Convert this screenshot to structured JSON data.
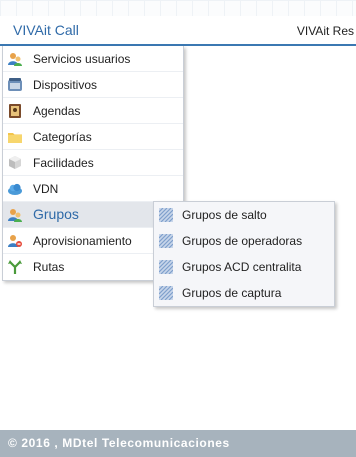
{
  "app": {
    "title": "VIVAit Call",
    "right_text": "VIVAit Res"
  },
  "menu": {
    "items": [
      {
        "label": "Servicios usuarios",
        "icon": "users-icon"
      },
      {
        "label": "Dispositivos",
        "icon": "phone-icon"
      },
      {
        "label": "Agendas",
        "icon": "address-book-icon"
      },
      {
        "label": "Categorías",
        "icon": "folder-icon"
      },
      {
        "label": "Facilidades",
        "icon": "cubes-icon"
      },
      {
        "label": "VDN",
        "icon": "cloud-icon"
      },
      {
        "label": "Grupos",
        "icon": "users-icon",
        "active": true
      },
      {
        "label": "Aprovisionamiento",
        "icon": "user-provision-icon"
      },
      {
        "label": "Rutas",
        "icon": "route-icon"
      }
    ]
  },
  "submenu": {
    "items": [
      {
        "label": "Grupos de salto",
        "icon": "group-pattern-icon"
      },
      {
        "label": "Grupos de operadoras",
        "icon": "group-pattern-icon"
      },
      {
        "label": "Grupos ACD centralita",
        "icon": "group-pattern-icon"
      },
      {
        "label": "Grupos de captura",
        "icon": "group-pattern-icon"
      }
    ]
  },
  "footer": {
    "text": "© 2016 , MDtel Telecomunicaciones"
  },
  "colors": {
    "accent": "#2f6aa8",
    "header_line": "#3b78b2",
    "footer_bg": "#a7b3bd",
    "active_bg": "#e3e6eb"
  }
}
